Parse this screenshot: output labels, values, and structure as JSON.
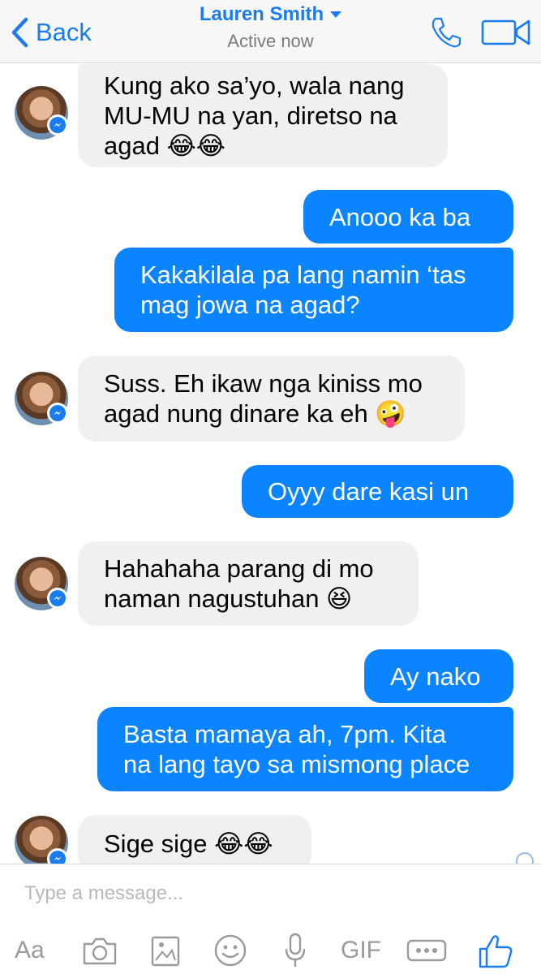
{
  "header": {
    "back_label": "Back",
    "contact_name": "Lauren Smith",
    "status": "Active now",
    "icons": [
      "chevron-left-icon",
      "caret-down-icon",
      "phone-icon",
      "video-camera-icon"
    ]
  },
  "messages": [
    {
      "from": "contact",
      "text": "Kung ako sa’yo, wala nang\nMU-MU na yan, diretso na\nagad 😂😂"
    },
    {
      "from": "me",
      "text": "Anooo ka ba"
    },
    {
      "from": "me",
      "text": "Kakakilala pa lang namin ‘tas\nmag jowa na agad?"
    },
    {
      "from": "contact",
      "text": "Suss. Eh ikaw nga kiniss mo\nagad nung dinare ka eh 🤪"
    },
    {
      "from": "me",
      "text": "Oyyy dare kasi un"
    },
    {
      "from": "contact",
      "text": "Hahahaha parang di mo\nnaman nagustuhan 😆"
    },
    {
      "from": "me",
      "text": "Ay nako"
    },
    {
      "from": "me",
      "text": "Basta mamaya ah, 7pm. Kita\nna lang tayo sa mismong place"
    },
    {
      "from": "contact",
      "text": "Sige sige 😂😂"
    }
  ],
  "composer": {
    "placeholder": "Type a message...",
    "aa_label": "Aa",
    "gif_label": "GIF",
    "icons": [
      "camera-icon",
      "gallery-icon",
      "emoji-icon",
      "microphone-icon",
      "more-icon",
      "thumbs-up-icon"
    ]
  },
  "colors": {
    "accent": "#1a7cf3",
    "outgoing_bubble": "#0a84ff",
    "incoming_bubble": "#f1f0f0"
  }
}
